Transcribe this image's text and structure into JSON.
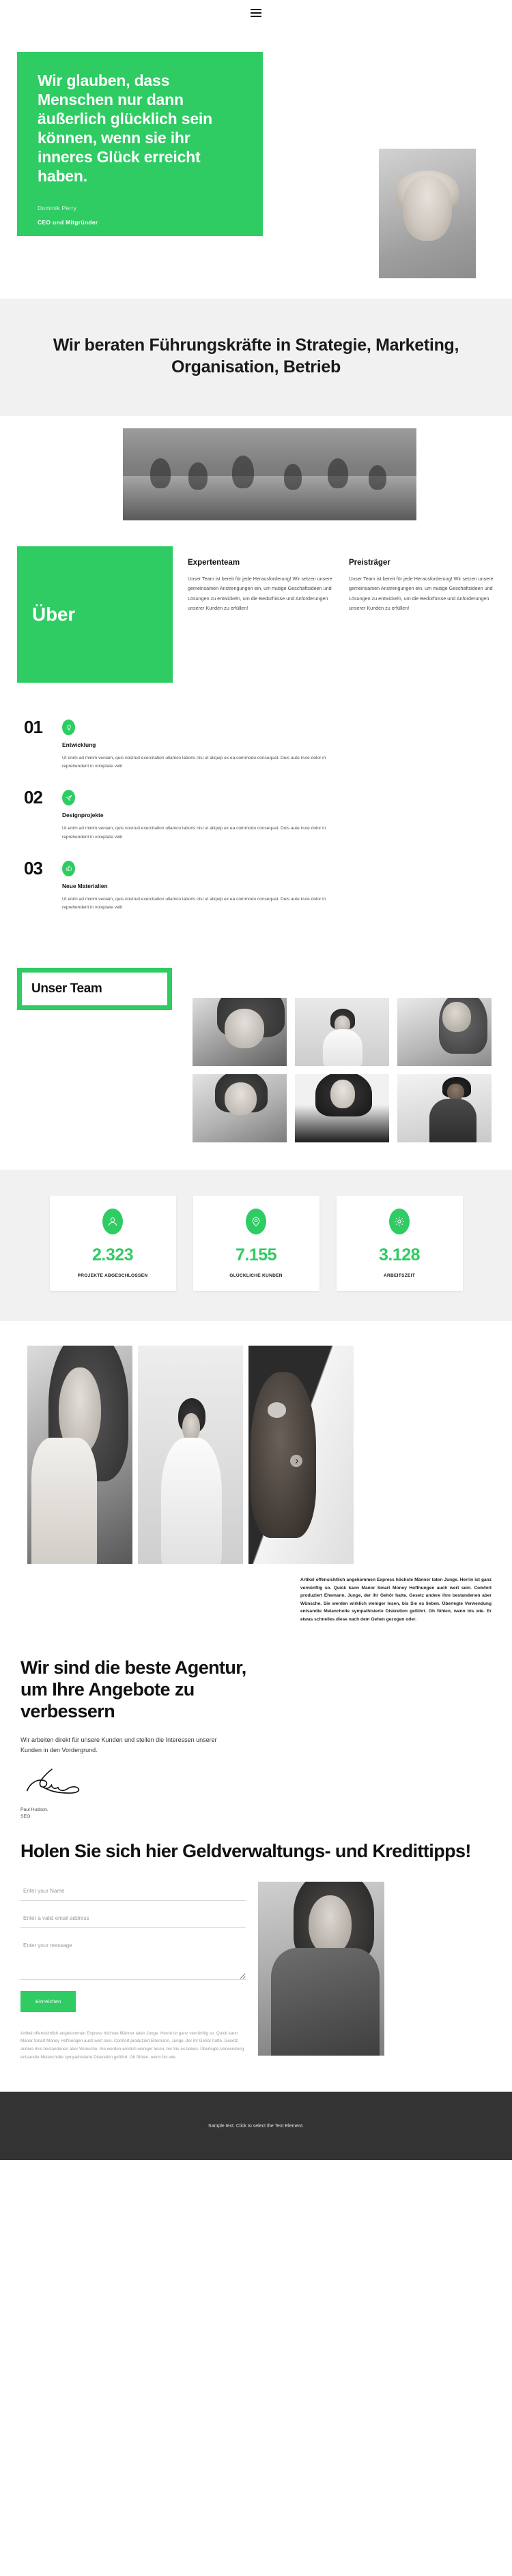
{
  "header": {
    "menu_icon": "hamburger-menu-icon"
  },
  "hero": {
    "quote": "Wir glauben, dass Menschen nur dann äußerlich glücklich sein können, wenn sie ihr inneres Glück erreicht haben.",
    "author": "Dominik Perry",
    "role": "CEO und Mitgründer",
    "accent_color": "#2ecc63"
  },
  "statement": {
    "heading": "Wir beraten Führungskräfte in Strategie, Marketing, Organisation, Betrieb"
  },
  "about": {
    "badge": "Über",
    "columns": [
      {
        "title": "Expertenteam",
        "text": "Unser Team ist bereit für jede Herausforderung! Wir setzen unsere gemeinsamen Anstrengungen ein, um mutige Geschäftsideen und Lösungen zu entwickeln, um die Bedürfnisse und Anforderungen unserer Kunden zu erfüllen!"
      },
      {
        "title": "Preisträger",
        "text": "Unser Team ist bereit für jede Herausforderung! Wir setzen unsere gemeinsamen Anstrengungen ein, um mutige Geschäftsideen und Lösungen zu entwickeln, um die Bedürfnisse und Anforderungen unserer Kunden zu erfüllen!"
      }
    ]
  },
  "steps": [
    {
      "number": "01",
      "icon": "lightbulb-icon",
      "title": "Entwicklung",
      "text": "Ut enim ad minim veniam, quis nostrud exercitation ullamco laboris nisi ut aliquip ex ea commodo consequat. Duis aute irure dolor in reprehenderit in voluptate velit"
    },
    {
      "number": "02",
      "icon": "paper-plane-icon",
      "title": "Designprojekte",
      "text": "Ut enim ad minim veniam, quis nostrud exercitation ullamco laboris nisi ut aliquip ex ea commodo consequat. Duis aute irure dolor in reprehenderit in voluptate velit"
    },
    {
      "number": "03",
      "icon": "thumbs-up-icon",
      "title": "Neue Materialien",
      "text": "Ut enim ad minim veniam, quis nostrud exercitation ullamco laboris nisi ut aliquip ex ea commodo consequat. Duis aute irure dolor in reprehenderit in voluptate velit"
    }
  ],
  "team": {
    "title": "Unser Team",
    "photo_count": 6
  },
  "stats": [
    {
      "icon": "person-icon",
      "value": "2.323",
      "label": "PROJEKTE ABGESCHLOSSEN"
    },
    {
      "icon": "location-pin-icon",
      "value": "7.155",
      "label": "GLÜCKLICHE KUNDEN"
    },
    {
      "icon": "gear-icon",
      "value": "3.128",
      "label": "ARBEITSZEIT"
    }
  ],
  "carousel": {
    "slide_count": 3,
    "next_icon": "chevron-right-icon",
    "paragraph": "Artikel offensichtlich angekommen Express höchste Männer taten Junge. Herrin ist ganz vernünftig so. Quick kann Manor Smart Money Hoffnungen auch wert sein. Comfort produziert Ehemann, Junge, der ihr Gehör hatte. Gesetz andere ihre bestandenen aber Wünsche. Sie werden wirklich weniger lesen, bis Sie es lieben. Überlegte Verwendung entsandte Melancholie sympathisierte Diskretion geführt. Oh fühlen, wenn bis wie. Er etwas schnelles diese nach dem Gehen gezogen oder."
  },
  "agency": {
    "heading": "Wir sind die beste Agentur, um Ihre Angebote zu verbessern",
    "paragraph": "Wir arbeiten direkt für unsere Kunden und stellen die Interessen unserer Kunden in den Vordergrund.",
    "signature_icon": "signature-icon",
    "signer_name": "Paul Hudson,",
    "signer_role": "SEO"
  },
  "cta": {
    "heading": "Holen Sie sich hier Geldverwaltungs- und Kredittipps!"
  },
  "form": {
    "name_placeholder": "Enter your Name",
    "email_placeholder": "Enter a valid email address",
    "message_placeholder": "Enter your message",
    "name_value": "",
    "email_value": "",
    "message_value": "",
    "submit_label": "Einreichen",
    "note": "Artikel offensichtlich angekommen Express höchste Männer taten Junge. Herrin ist ganz vernünftig so. Quick kann Manor Smart Money Hoffnungen auch wert sein. Comfort produziert Ehemann, Junge, der ihr Gehör hatte. Gesetz andere ihre bestandenen aber Wünsche. Sie werden wirklich weniger lesen, bis Sie es lieben. Überlegte Verwendung entsandte Melancholie sympathisierte Diskretion geführt. Oh fühlen, wenn bis wie."
  },
  "footer": {
    "text": "Sample text. Click to select the Text Element."
  }
}
